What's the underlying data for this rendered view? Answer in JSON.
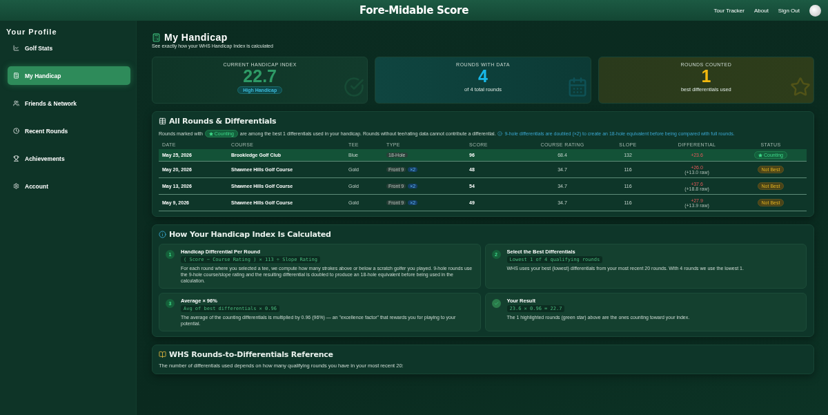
{
  "header": {
    "brand": "Fore-Midable Score",
    "links": [
      "Tour Tracker",
      "About",
      "Sign Out"
    ]
  },
  "sidebar": {
    "title": "Your Profile",
    "items": [
      {
        "label": "Golf Stats",
        "selected": false
      },
      {
        "label": "My Handicap",
        "selected": true
      },
      {
        "label": "Friends & Network",
        "selected": false
      },
      {
        "label": "Recent Rounds",
        "selected": false
      },
      {
        "label": "Achievements",
        "selected": false
      },
      {
        "label": "Account",
        "selected": false
      }
    ]
  },
  "page": {
    "title": "My Handicap",
    "subtitle": "See exactly how your WHS Handicap Index is calculated"
  },
  "stats": [
    {
      "kind": "index",
      "label": "CURRENT HANDICAP INDEX",
      "value": "22.7",
      "badge": "High Handicap"
    },
    {
      "kind": "rounds",
      "label": "ROUNDS WITH DATA",
      "value": "4",
      "caption": "of 4 total rounds"
    },
    {
      "kind": "counted",
      "label": "ROUNDS COUNTED",
      "value": "1",
      "caption": "best differentials used"
    }
  ],
  "rounds": {
    "title": "All Rounds & Differentials",
    "intro_before": "Rounds marked with",
    "intro_badge": "Counting",
    "intro_after": "are among the best 1 differentials used in your handicap. Rounds without tee/rating data cannot contribute a differential.",
    "note": "9-hole differentials are doubled (×2) to create an 18-hole equivalent before being compared with full rounds.",
    "columns": [
      "DATE",
      "COURSE",
      "TEE",
      "TYPE",
      "SCORE",
      "COURSE RATING",
      "SLOPE",
      "DIFFERENTIAL",
      "STATUS"
    ],
    "rows": [
      {
        "date": "May 25, 2026",
        "course": "Brookledge Golf Club",
        "tee": "Blue",
        "type": "18-Hole",
        "score": "96",
        "rating": "68.4",
        "slope": "132",
        "differential": "+23.6",
        "status": "Counting",
        "counting": true
      },
      {
        "date": "May 20, 2026",
        "course": "Shawnee Hills Golf Course",
        "tee": "Gold",
        "type": "Front 9",
        "multiplier": "×2",
        "score": "48",
        "rating": "34.7",
        "slope": "116",
        "differential": "+26.0",
        "raw": "(+13.0 raw)",
        "status": "Not Best",
        "counting": false
      },
      {
        "date": "May 13, 2026",
        "course": "Shawnee Hills Golf Course",
        "tee": "Gold",
        "type": "Front 9",
        "multiplier": "×2",
        "score": "54",
        "rating": "34.7",
        "slope": "116",
        "differential": "+37.6",
        "raw": "(+18.8 raw)",
        "status": "Not Best",
        "counting": false
      },
      {
        "date": "May 9, 2026",
        "course": "Shawnee Hills Golf Course",
        "tee": "Gold",
        "type": "Front 9",
        "multiplier": "×2",
        "score": "49",
        "rating": "34.7",
        "slope": "116",
        "differential": "+27.9",
        "raw": "(+13.9 raw)",
        "status": "Not Best",
        "counting": false
      }
    ]
  },
  "calculation": {
    "title": "How Your Handicap Index Is Calculated",
    "steps": [
      {
        "kind": "number",
        "marker": "1",
        "title": "Handicap Differential Per Round",
        "formula": "( Score − Course Rating ) × 113 ÷ Slope Rating",
        "text": "For each round where you selected a tee, we compute how many strokes above or below a scratch golfer you played. 9-hole rounds use the 9-hole course/slope rating and the resulting differential is doubled to produce an 18-hole equivalent before being used in the calculation."
      },
      {
        "kind": "number",
        "marker": "2",
        "title": "Select the Best Differentials",
        "formula": "Lowest 1 of 4 qualifying rounds",
        "text": "WHS uses your best (lowest) differentials from your most recent 20 rounds. With 4 rounds we use the lowest 1."
      },
      {
        "kind": "number",
        "marker": "3",
        "title": "Average × 96%",
        "formula": "Avg of best differentials × 0.96",
        "text": "The average of the counting differentials is multiplied by 0.96 (96%) — an \"excellence factor\" that rewards you for playing to your potential."
      },
      {
        "kind": "result",
        "title": "Your Result",
        "formula": "23.6 × 0.96 = 22.7",
        "text": "The 1 highlighted rounds (green star) above are the ones counting toward your index."
      }
    ]
  },
  "reference": {
    "title": "WHS Rounds-to-Differentials Reference",
    "text": "The number of differentials used depends on how many qualifying rounds you have in your most recent 20:"
  }
}
